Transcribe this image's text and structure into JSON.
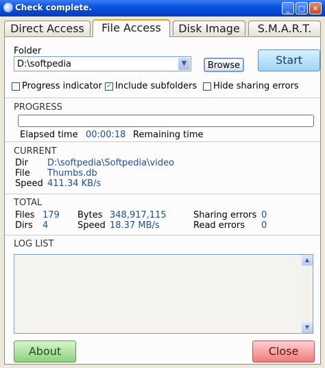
{
  "window": {
    "title": "Check complete."
  },
  "tabs": [
    {
      "label": "Direct Access",
      "active": false
    },
    {
      "label": "File Access",
      "active": true
    },
    {
      "label": "Disk Image",
      "active": false
    },
    {
      "label": "S.M.A.R.T.",
      "active": false
    }
  ],
  "folder": {
    "label": "Folder",
    "value": "D:\\softpedia",
    "browse_label": "Browse",
    "start_label": "Start"
  },
  "options": {
    "progress_indicator": {
      "label": "Progress indicator",
      "checked": false
    },
    "include_subfolders": {
      "label": "Include subfolders",
      "checked": true
    },
    "hide_sharing_errors": {
      "label": "Hide sharing errors",
      "checked": false
    }
  },
  "progress": {
    "title": "PROGRESS",
    "fraction": 0,
    "elapsed_label": "Elapsed time",
    "elapsed_value": "00:00:18",
    "remaining_label": "Remaining time",
    "remaining_value": ""
  },
  "current": {
    "title": "CURRENT",
    "dir_label": "Dir",
    "dir_value": "D:\\softpedia\\Softpedia\\video",
    "file_label": "File",
    "file_value": "Thumbs.db",
    "speed_label": "Speed",
    "speed_value": "411.34 KB/s"
  },
  "total": {
    "title": "TOTAL",
    "files_label": "Files",
    "files_value": "179",
    "dirs_label": "Dirs",
    "dirs_value": "4",
    "bytes_label": "Bytes",
    "bytes_value": "348,917,115",
    "speed_label": "Speed",
    "speed_value": "18.37 MB/s",
    "sharing_errors_label": "Sharing errors",
    "sharing_errors_value": "0",
    "read_errors_label": "Read errors",
    "read_errors_value": "0"
  },
  "log": {
    "title": "LOG LIST"
  },
  "footer": {
    "about_label": "About",
    "close_label": "Close"
  },
  "colors": {
    "accent_tab": "#f5a300",
    "value_blue": "#1a4fa0",
    "start_bg": "#9dd6f5",
    "about_bg": "#8cd27a",
    "close_bg": "#f07a7a"
  }
}
